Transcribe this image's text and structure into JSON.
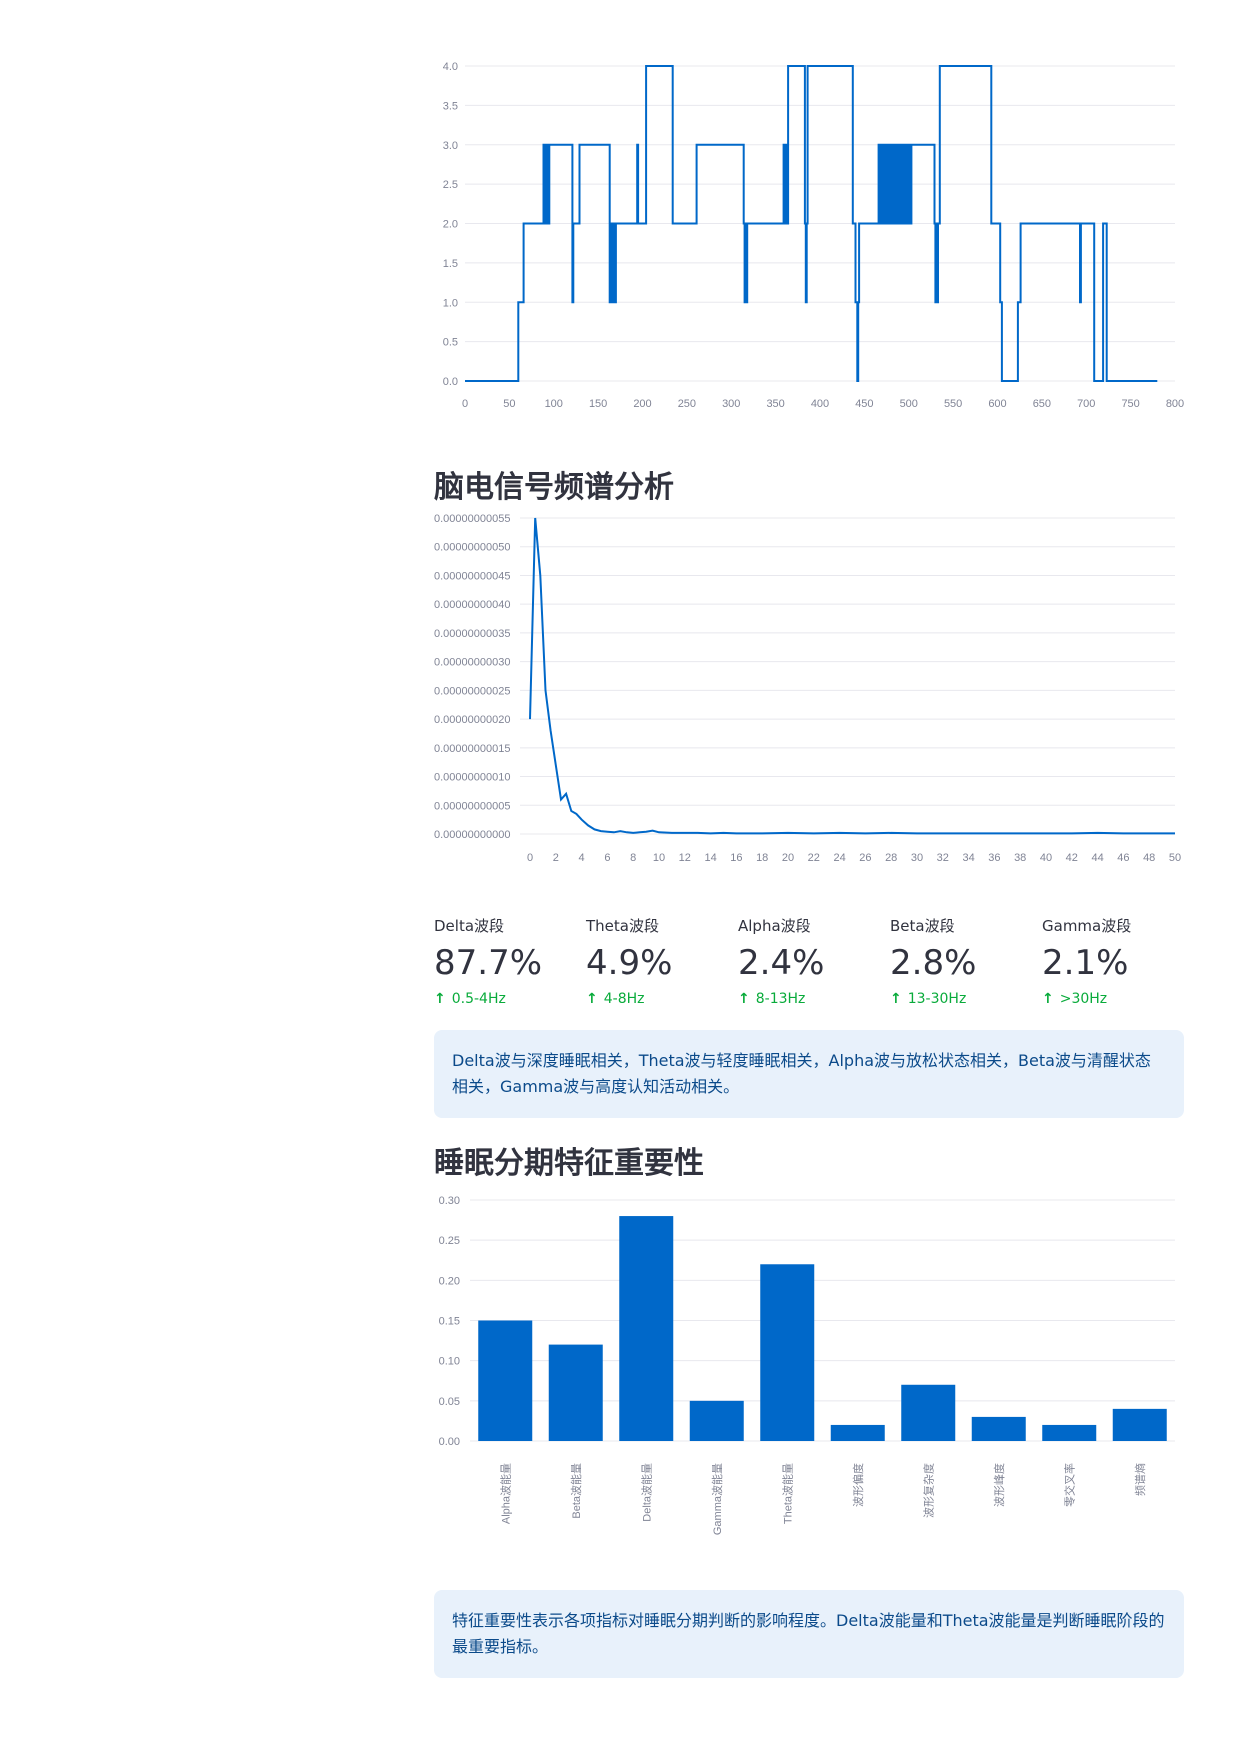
{
  "hypnogram": {
    "chart_data": {
      "type": "line",
      "x_ticks": [
        "0",
        "50",
        "100",
        "150",
        "200",
        "250",
        "300",
        "350",
        "400",
        "450",
        "500",
        "550",
        "600",
        "650",
        "700",
        "750",
        "800"
      ],
      "y_ticks": [
        "0.0",
        "0.5",
        "1.0",
        "1.5",
        "2.0",
        "2.5",
        "3.0",
        "3.5",
        "4.0"
      ],
      "xlim": [
        0,
        800
      ],
      "ylim": [
        0,
        4
      ],
      "color": "#0068c9",
      "segments": [
        [
          0,
          0
        ],
        [
          57,
          0
        ],
        [
          60,
          1
        ],
        [
          65,
          1
        ],
        [
          66,
          2
        ],
        [
          88,
          2
        ],
        [
          88.5,
          3
        ],
        [
          89,
          2
        ],
        [
          90,
          3
        ],
        [
          91,
          2
        ],
        [
          92,
          3
        ],
        [
          93,
          2
        ],
        [
          94,
          2
        ],
        [
          95,
          3
        ],
        [
          120,
          3
        ],
        [
          121,
          1
        ],
        [
          122,
          2
        ],
        [
          128,
          2
        ],
        [
          129,
          3
        ],
        [
          162,
          3
        ],
        [
          163,
          1
        ],
        [
          164,
          2
        ],
        [
          165,
          1
        ],
        [
          166,
          2
        ],
        [
          167,
          1
        ],
        [
          168,
          2
        ],
        [
          169,
          1
        ],
        [
          170,
          2
        ],
        [
          193,
          2
        ],
        [
          194,
          3
        ],
        [
          195,
          2
        ],
        [
          203,
          2
        ],
        [
          204,
          4
        ],
        [
          233,
          4
        ],
        [
          234,
          2
        ],
        [
          260,
          2
        ],
        [
          261,
          3
        ],
        [
          313,
          3
        ],
        [
          314,
          2
        ],
        [
          315,
          1
        ],
        [
          316,
          2
        ],
        [
          317,
          1
        ],
        [
          318,
          2
        ],
        [
          358,
          2
        ],
        [
          359,
          3
        ],
        [
          360,
          2
        ],
        [
          361,
          3
        ],
        [
          362,
          2
        ],
        [
          363,
          2
        ],
        [
          364,
          4
        ],
        [
          382,
          4
        ],
        [
          383,
          2
        ],
        [
          384,
          1
        ],
        [
          385,
          2
        ],
        [
          386,
          4
        ],
        [
          436,
          4
        ],
        [
          437,
          2
        ],
        [
          438,
          2
        ],
        [
          440,
          1
        ],
        [
          442,
          0
        ],
        [
          443,
          1
        ],
        [
          444,
          2
        ],
        [
          465,
          2
        ],
        [
          466,
          3
        ],
        [
          467,
          2
        ],
        [
          469,
          3
        ],
        [
          470,
          2
        ],
        [
          472,
          3
        ],
        [
          473,
          2
        ],
        [
          475,
          3
        ],
        [
          476,
          2
        ],
        [
          478,
          3
        ],
        [
          479,
          2
        ],
        [
          481,
          3
        ],
        [
          482,
          2
        ],
        [
          484,
          3
        ],
        [
          485,
          2
        ],
        [
          487,
          3
        ],
        [
          488,
          2
        ],
        [
          489,
          2
        ],
        [
          490,
          3
        ],
        [
          491,
          2
        ],
        [
          492,
          3
        ],
        [
          493,
          2
        ],
        [
          494,
          3
        ],
        [
          495,
          2
        ],
        [
          497,
          3
        ],
        [
          498,
          2
        ],
        [
          500,
          3
        ],
        [
          501,
          2
        ],
        [
          503,
          3
        ],
        [
          528,
          3
        ],
        [
          529,
          2
        ],
        [
          530,
          1
        ],
        [
          531,
          2
        ],
        [
          532,
          1
        ],
        [
          533,
          2
        ],
        [
          534,
          2
        ],
        [
          535,
          4
        ],
        [
          592,
          4
        ],
        [
          593,
          2
        ],
        [
          601,
          2
        ],
        [
          603,
          1
        ],
        [
          605,
          0
        ],
        [
          622,
          0
        ],
        [
          623,
          1
        ],
        [
          625,
          1
        ],
        [
          626,
          2
        ],
        [
          692,
          2
        ],
        [
          693,
          1
        ],
        [
          694,
          2
        ],
        [
          708,
          2
        ],
        [
          709,
          0
        ],
        [
          718,
          0
        ],
        [
          719,
          2
        ],
        [
          722,
          2
        ],
        [
          723,
          0
        ],
        [
          780,
          0
        ]
      ]
    }
  },
  "spectrum": {
    "title": "脑电信号频谱分析",
    "chart_data": {
      "type": "line",
      "x_ticks": [
        "0",
        "2",
        "4",
        "6",
        "8",
        "10",
        "12",
        "14",
        "16",
        "18",
        "20",
        "22",
        "24",
        "26",
        "28",
        "30",
        "32",
        "34",
        "36",
        "38",
        "40",
        "42",
        "44",
        "46",
        "48",
        "50"
      ],
      "y_ticks": [
        "0.00000000000",
        "0.00000000005",
        "0.00000000010",
        "0.00000000015",
        "0.00000000020",
        "0.00000000025",
        "0.00000000030",
        "0.00000000035",
        "0.00000000040",
        "0.00000000045",
        "0.00000000050",
        "0.00000000055"
      ],
      "xlim": [
        0,
        50
      ],
      "ylim": [
        0,
        5.5e-11
      ],
      "color": "#0068c9",
      "x": [
        0,
        0.4,
        0.8,
        1.2,
        1.6,
        2.0,
        2.4,
        2.8,
        3.2,
        3.6,
        4.0,
        4.5,
        5.0,
        5.5,
        6.0,
        6.5,
        7.0,
        7.5,
        8.0,
        8.5,
        9.0,
        9.5,
        10.0,
        11,
        12,
        13,
        14,
        15,
        16,
        18,
        20,
        22,
        24,
        26,
        28,
        30,
        32,
        34,
        36,
        38,
        40,
        42,
        44,
        46,
        48,
        50
      ],
      "y": [
        2e-11,
        5.5e-11,
        4.5e-11,
        2.5e-11,
        1.8e-11,
        1.2e-11,
        6e-12,
        7e-12,
        4e-12,
        3.5e-12,
        2.5e-12,
        1.5e-12,
        8e-13,
        5e-13,
        4e-13,
        3e-13,
        5e-13,
        3e-13,
        2e-13,
        3e-13,
        4e-13,
        6e-13,
        3e-13,
        2e-13,
        2e-13,
        2e-13,
        1e-13,
        2e-13,
        1e-13,
        1e-13,
        2e-13,
        1e-13,
        2e-13,
        1e-13,
        2e-13,
        1e-13,
        1e-13,
        1e-13,
        1e-13,
        1e-13,
        1e-13,
        1e-13,
        2e-13,
        1e-13,
        1e-13,
        1e-13
      ]
    }
  },
  "metrics": [
    {
      "label": "Delta波段",
      "value": "87.7%",
      "delta": "0.5-4Hz"
    },
    {
      "label": "Theta波段",
      "value": "4.9%",
      "delta": "4-8Hz"
    },
    {
      "label": "Alpha波段",
      "value": "2.4%",
      "delta": "8-13Hz"
    },
    {
      "label": "Beta波段",
      "value": "2.8%",
      "delta": "13-30Hz"
    },
    {
      "label": "Gamma波段",
      "value": "2.1%",
      "delta": ">30Hz"
    }
  ],
  "info1": "Delta波与深度睡眠相关，Theta波与轻度睡眠相关，Alpha波与放松状态相关，Beta波与清醒状态相关，Gamma波与高度认知活动相关。",
  "importance": {
    "title": "睡眠分期特征重要性",
    "chart_data": {
      "type": "bar",
      "categories": [
        "Alpha波能量",
        "Beta波能量",
        "Delta波能量",
        "Gamma波能量",
        "Theta波能量",
        "波形偏度",
        "波形复杂度",
        "波形峰度",
        "零交叉率",
        "频谱熵"
      ],
      "values": [
        0.15,
        0.12,
        0.28,
        0.05,
        0.22,
        0.02,
        0.07,
        0.03,
        0.02,
        0.04
      ],
      "y_ticks": [
        "0.00",
        "0.05",
        "0.10",
        "0.15",
        "0.20",
        "0.25",
        "0.30"
      ],
      "ylim": [
        0,
        0.3
      ],
      "color": "#0068c9"
    }
  },
  "info2": "特征重要性表示各项指标对睡眠分期判断的影响程度。Delta波能量和Theta波能量是判断睡眠阶段的最重要指标。"
}
